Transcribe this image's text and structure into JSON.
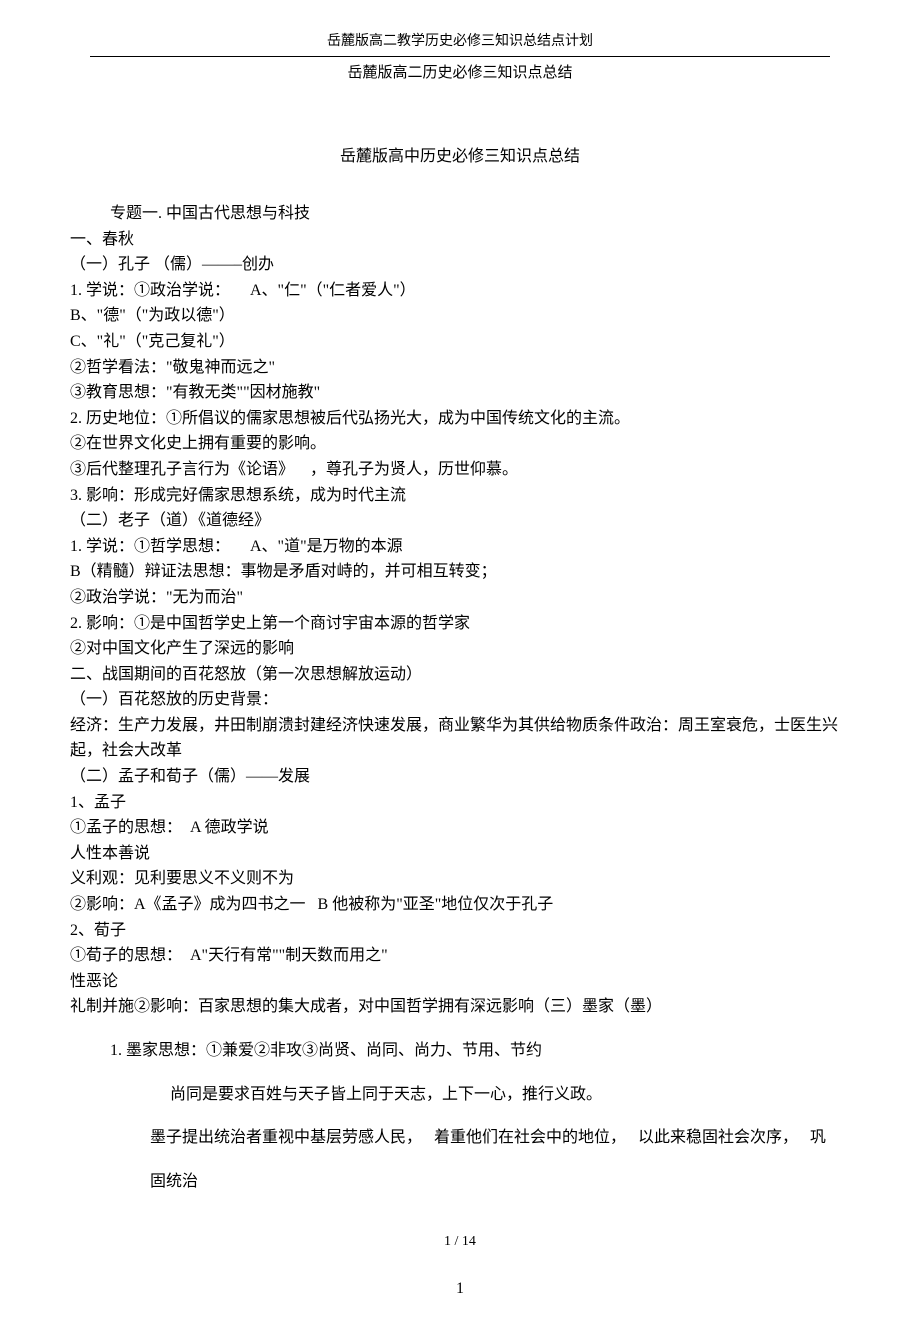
{
  "header": "岳麓版高二教学历史必修三知识总结点计划",
  "subheader": "岳麓版高二历史必修三知识点总结",
  "title": "岳麓版高中历史必修三知识点总结",
  "topic": "专题一. 中国古代思想与科技",
  "lines": [
    "一、春秋",
    "（一）孔子 （儒）——–创办",
    "1. 学说：①政治学说：     A、\"仁\"（\"仁者爱人\"）",
    "B、\"德\"（\"为政以德\"）",
    "C、\"礼\"（\"克己复礼\"）",
    "②哲学看法：\"敬鬼神而远之\"",
    "③教育思想：\"有教无类\"\"因材施教\"",
    "2. 历史地位：①所倡议的儒家思想被后代弘扬光大，成为中国传统文化的主流。",
    "②在世界文化史上拥有重要的影响。",
    "③后代整理孔子言行为《论语》    ，尊孔子为贤人，历世仰慕。",
    "3. 影响：形成完好儒家思想系统，成为时代主流",
    "（二）老子（道）《道德经》",
    "1. 学说：①哲学思想：     A、\"道\"是万物的本源",
    "B（精髓）辩证法思想：事物是矛盾对峙的，并可相互转变；",
    "②政治学说：\"无为而治\"",
    "2. 影响：①是中国哲学史上第一个商讨宇宙本源的哲学家",
    "②对中国文化产生了深远的影响",
    "二、战国期间的百花怒放（第一次思想解放运动）",
    "（一）百花怒放的历史背景：",
    "经济：生产力发展，井田制崩溃封建经济快速发展，商业繁华为其供给物质条件政治：周王室衰危，士医生兴起，社会大改革",
    "（二）孟子和荀子（儒）——发展",
    "1、孟子",
    "①孟子的思想：  A 德政学说",
    "人性本善说",
    "义利观：见利要思义不义则不为",
    "②影响：A《孟子》成为四书之一   B 他被称为\"亚圣\"地位仅次于孔子",
    "2、荀子",
    "①荀子的思想：  A\"天行有常\"\"制天数而用之\"",
    "性恶论",
    "礼制并施②影响：百家思想的集大成者，对中国哲学拥有深远影响（三）墨家（墨）"
  ],
  "list1": "1. 墨家思想：①兼爱②非攻③尚贤、尚同、尚力、节用、节约",
  "list2": "尚同是要求百姓与天子皆上同于天志，上下一心，推行义政。",
  "list3a": "墨子提出统治者重视中基层劳感人民，   着重他们在社会中的地位，   以此来稳固社会次序，   巩",
  "list3b": "固统治",
  "pagenum": "1 / 14",
  "footer": "1"
}
